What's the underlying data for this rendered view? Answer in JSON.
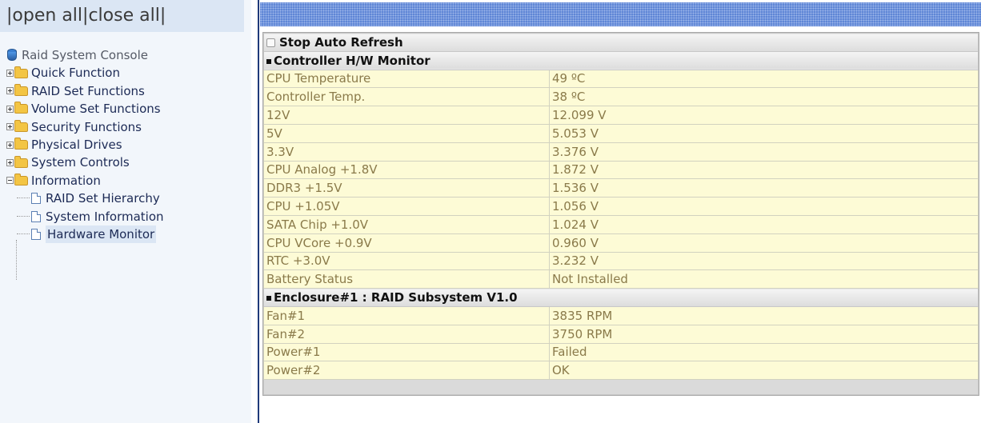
{
  "nav": {
    "open_all": "open all",
    "close_all": "close all",
    "sep": "|"
  },
  "tree": {
    "root_label": "Raid System Console",
    "folders": [
      {
        "label": "Quick Function"
      },
      {
        "label": "RAID Set Functions"
      },
      {
        "label": "Volume Set Functions"
      },
      {
        "label": "Security Functions"
      },
      {
        "label": "Physical Drives"
      },
      {
        "label": "System Controls"
      },
      {
        "label": "Information"
      }
    ],
    "info_children": [
      {
        "label": "RAID Set Hierarchy"
      },
      {
        "label": "System Information"
      },
      {
        "label": "Hardware Monitor"
      }
    ]
  },
  "panel": {
    "auto_refresh_label": "Stop Auto Refresh",
    "controller_title": "Controller H/W Monitor",
    "controller_rows": [
      {
        "name": "CPU Temperature",
        "value": "49 ºC"
      },
      {
        "name": "Controller Temp.",
        "value": "38 ºC"
      },
      {
        "name": "12V",
        "value": "12.099 V"
      },
      {
        "name": "5V",
        "value": "5.053 V"
      },
      {
        "name": "3.3V",
        "value": "3.376 V"
      },
      {
        "name": "CPU Analog +1.8V",
        "value": "1.872 V"
      },
      {
        "name": "DDR3 +1.5V",
        "value": "1.536 V"
      },
      {
        "name": "CPU +1.05V",
        "value": "1.056 V"
      },
      {
        "name": "SATA Chip +1.0V",
        "value": "1.024 V"
      },
      {
        "name": "CPU VCore +0.9V",
        "value": "0.960 V"
      },
      {
        "name": "RTC +3.0V",
        "value": "3.232 V"
      },
      {
        "name": "Battery Status",
        "value": "Not Installed"
      }
    ],
    "enclosure_title": "Enclosure#1 : RAID Subsystem V1.0",
    "enclosure_rows": [
      {
        "name": "Fan#1",
        "value": "3835 RPM"
      },
      {
        "name": "Fan#2",
        "value": "3750 RPM"
      },
      {
        "name": "Power#1",
        "value": "Failed"
      },
      {
        "name": "Power#2",
        "value": "OK"
      }
    ]
  }
}
